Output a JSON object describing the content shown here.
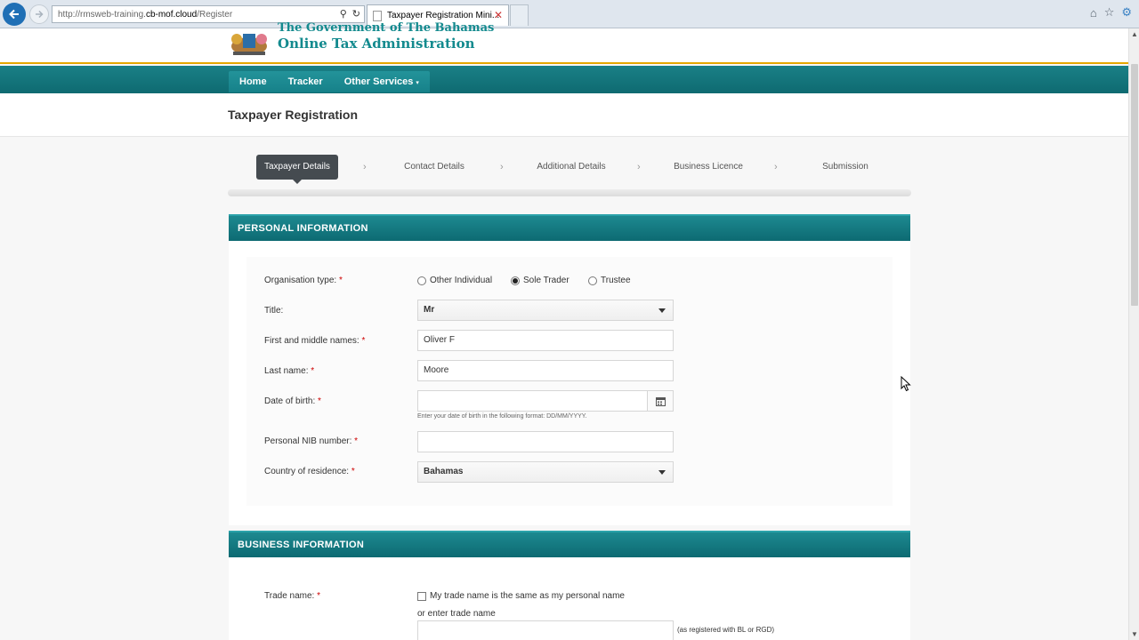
{
  "browser": {
    "url_prefix": "http://rmsweb-training.",
    "url_host": "cb-mof.cloud",
    "url_path": "/Register",
    "tab_title": "Taxpayer Registration Mini...",
    "tab_close": "✕"
  },
  "header": {
    "gov_line": "The Government of The Bahamas",
    "title": "Online Tax Administration"
  },
  "nav": {
    "items": [
      {
        "label": "Home"
      },
      {
        "label": "Tracker"
      },
      {
        "label": "Other Services"
      }
    ],
    "caret": "▾"
  },
  "page_title": "Taxpayer Registration",
  "steps": [
    {
      "label": "Taxpayer Details"
    },
    {
      "label": "Contact Details"
    },
    {
      "label": "Additional Details"
    },
    {
      "label": "Business Licence"
    },
    {
      "label": "Submission"
    }
  ],
  "step_separator": "›",
  "personal": {
    "heading": "PERSONAL INFORMATION",
    "required_mark": "*",
    "org_type_label": "Organisation type:",
    "org_options": [
      {
        "label": "Other Individual",
        "selected": false
      },
      {
        "label": "Sole Trader",
        "selected": true
      },
      {
        "label": "Trustee",
        "selected": false
      }
    ],
    "title_label": "Title:",
    "title_value": "Mr",
    "first_label": "First and middle names:",
    "first_value": "Oliver F",
    "last_label": "Last name:",
    "last_value": "Moore",
    "dob_label": "Date of birth:",
    "dob_value": "",
    "dob_hint": "Enter your date of birth in the following format: DD/MM/YYYY.",
    "nib_label": "Personal NIB number:",
    "nib_value": "",
    "country_label": "Country of residence:",
    "country_value": "Bahamas"
  },
  "business": {
    "heading": "BUSINESS INFORMATION",
    "trade_label": "Trade name:",
    "same_name_label": "My trade name is the same as my personal name",
    "same_name_checked": false,
    "or_enter": "or enter trade name",
    "registered_note": "(as registered with BL or RGD)",
    "trade_value": ""
  },
  "colors": {
    "teal": "#138a8e",
    "nav": "#0e6a71",
    "accent_gold": "#e5a800",
    "active_step": "#454b50"
  }
}
